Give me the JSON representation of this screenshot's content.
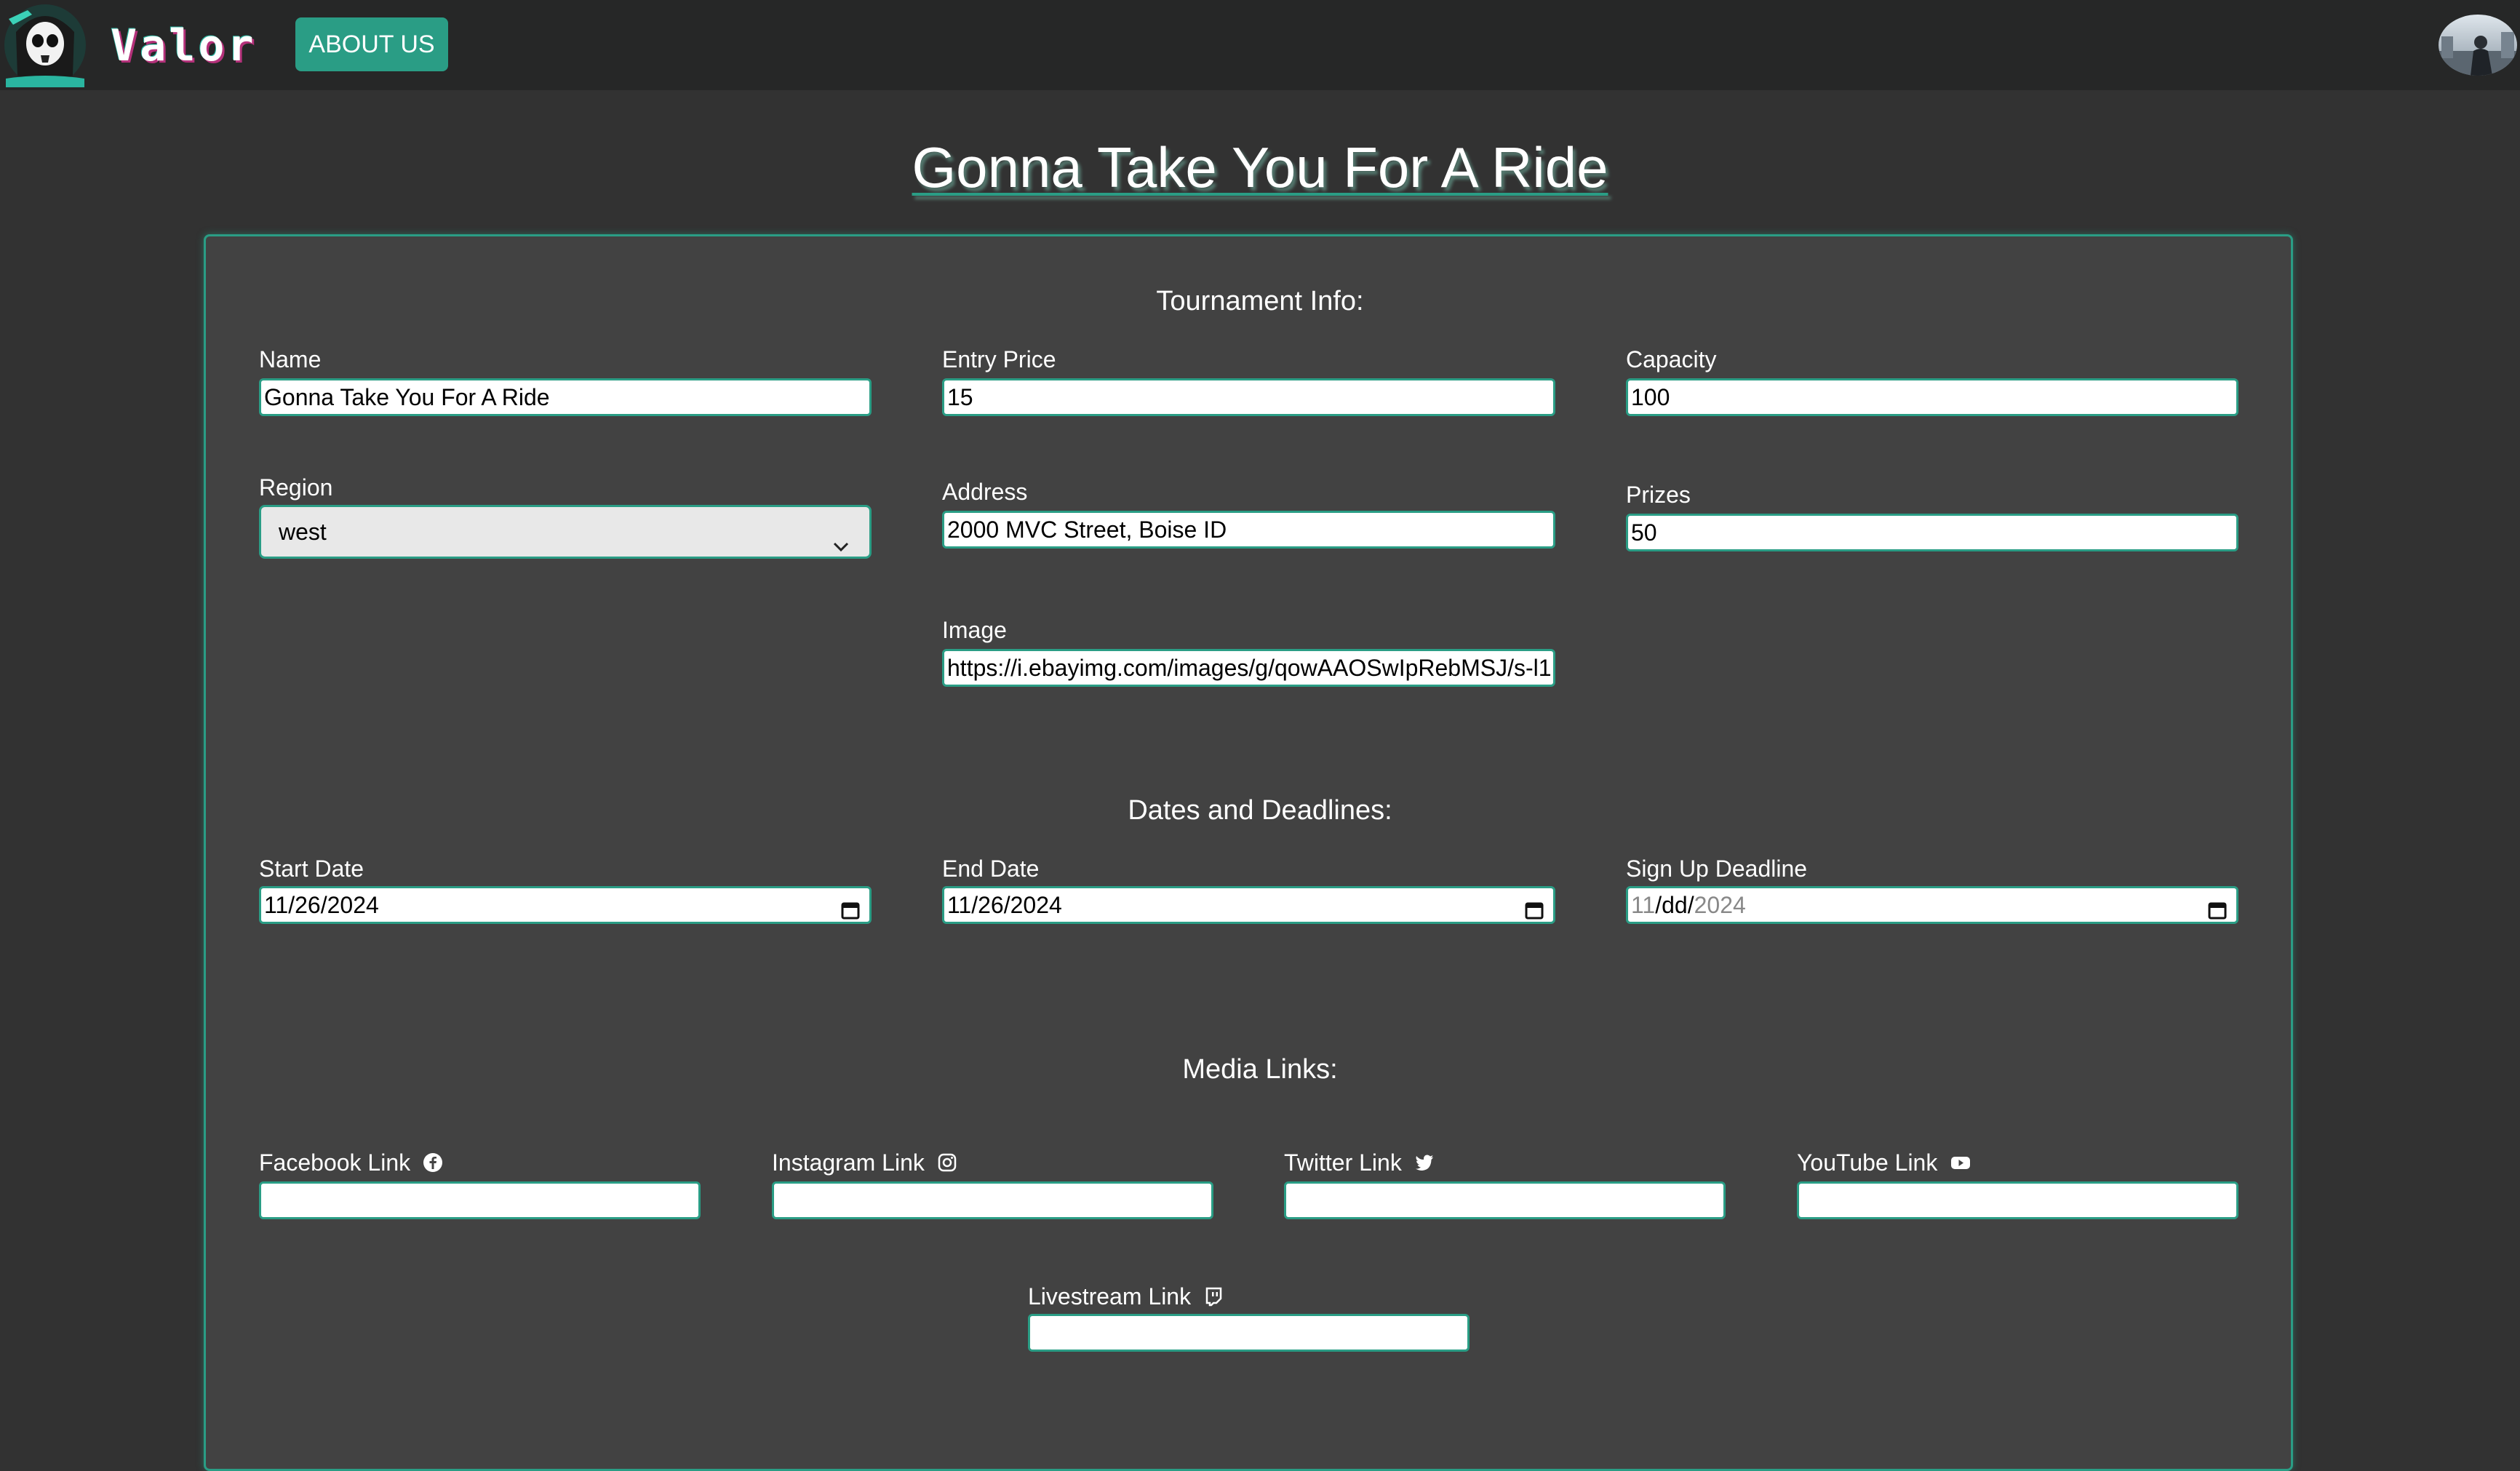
{
  "navbar": {
    "brand": "Valor",
    "about_label": "ABOUT US",
    "logo_icon": "skull-reaper-logo-icon",
    "avatar_icon": "user-avatar-icon"
  },
  "page": {
    "title": "Gonna Take You For A Ride"
  },
  "sections": {
    "tournament_info": "Tournament Info:",
    "dates": "Dates and Deadlines:",
    "media": "Media Links:"
  },
  "fields": {
    "name": {
      "label": "Name",
      "value": "Gonna Take You For A Ride"
    },
    "entry_price": {
      "label": "Entry Price",
      "value": "15"
    },
    "capacity": {
      "label": "Capacity",
      "value": "100"
    },
    "region": {
      "label": "Region",
      "value": "west"
    },
    "address": {
      "label": "Address",
      "value": "2000 MVC Street, Boise ID"
    },
    "prizes": {
      "label": "Prizes",
      "value": "50"
    },
    "image": {
      "label": "Image",
      "value": "https://i.ebayimg.com/images/g/qowAAOSwIpRebMSJ/s-l1"
    },
    "start_date": {
      "label": "Start Date",
      "value": "11/26/2024"
    },
    "end_date": {
      "label": "End Date",
      "value": "11/26/2024"
    },
    "signup_deadline": {
      "label": "Sign Up Deadline",
      "value_month": "11",
      "value_rest": "/dd/",
      "value_year": "2024"
    },
    "facebook": {
      "label": "Facebook Link",
      "value": "",
      "icon": "facebook-icon"
    },
    "instagram": {
      "label": "Instagram Link",
      "value": "",
      "icon": "instagram-icon"
    },
    "twitter": {
      "label": "Twitter Link",
      "value": "",
      "icon": "twitter-icon"
    },
    "youtube": {
      "label": "YouTube Link",
      "value": "",
      "icon": "youtube-icon"
    },
    "livestream": {
      "label": "Livestream Link",
      "value": "",
      "icon": "twitch-icon"
    }
  },
  "colors": {
    "page_bg": "#323232",
    "navbar_bg": "#262727",
    "panel_bg": "#424242",
    "accent": "#2a9d85"
  }
}
